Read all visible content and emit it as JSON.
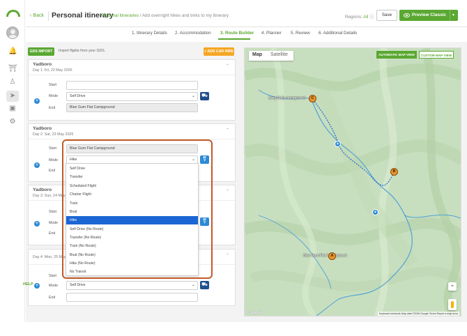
{
  "header": {
    "back_label": "Back",
    "title": "Personal itinerary",
    "subtitle_link": "Personal itineraries",
    "description": "Add overnight hikes and treks to my itinerary",
    "regions_label": "Regions:",
    "regions_value": "All",
    "save_label": "Save",
    "preview_label": "Preview Classic"
  },
  "steps": [
    {
      "label": "1. Itinerary Details"
    },
    {
      "label": "2. Accommodation"
    },
    {
      "label": "3. Route Builder"
    },
    {
      "label": "4. Planner"
    },
    {
      "label": "5. Review"
    },
    {
      "label": "6. Additional Details"
    }
  ],
  "left": {
    "gds_button": "GDS IMPORT",
    "gds_text": "Import flights from your GDS.",
    "car_hire_button": "+ ADD CAR HIRE",
    "help": "HELP",
    "labels": {
      "start": "Start",
      "mode": "Mode",
      "end": "End"
    },
    "days": [
      {
        "title": "Yadboro",
        "date": "Day 1: Fri, 22 May 2026",
        "start": "",
        "mode": "Self Drive",
        "end": "Blue Gum Flat Campground"
      },
      {
        "title": "Yadboro",
        "date": "Day 2: Sat, 23 May 2026",
        "start": "Blue Gum Flat Campground",
        "mode": "Hike",
        "end": ""
      },
      {
        "title": "Yadboro",
        "date": "Day 3: Sun, 24 May 2026",
        "start": "",
        "mode": "",
        "end": ""
      },
      {
        "title": "",
        "date": "Day 4: Mon, 25 May 2026",
        "start": "",
        "mode": "Self Drive",
        "end": ""
      }
    ]
  },
  "dropdown": {
    "options": [
      "Self Drive",
      "Transfer",
      "Scheduled Flight",
      "Charter Flight",
      "Train",
      "Boat",
      "Hike",
      "Self Drive (No Route)",
      "Transfer (No Route)",
      "Train (No Route)",
      "Boat (No Route)",
      "Hike (No Route)",
      "No Transit"
    ],
    "selected": "Hike"
  },
  "map": {
    "tab_map": "Map",
    "tab_satellite": "Satellite",
    "auto_view": "AUTOMATIC MAP VIEW",
    "custom_view": "CUSTOM MAP VIEW",
    "places": [
      "Long Gully campground",
      "Blue Gum Flat Campground"
    ],
    "markers": [
      "C",
      "B",
      "A"
    ],
    "google": "Google",
    "attribution": "Keyboard shortcuts   Map data ©2026 Google   Terms   Report a map error"
  },
  "colors": {
    "accent": "#5aa832",
    "orange": "#f5a623",
    "highlight_border": "#c35a28",
    "selection": "#1a66d4"
  }
}
